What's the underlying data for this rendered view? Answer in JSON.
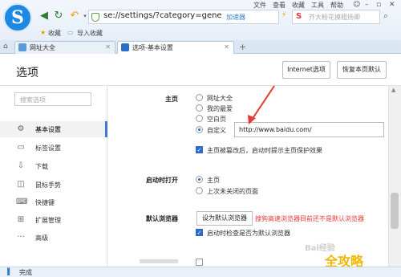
{
  "browser": {
    "logo_letter": "S",
    "address_url": "se://settings/?category=gene",
    "accelerator_label": "加速器",
    "search_placeholder": "芥大粉花摸粗扬卿",
    "menu": [
      "文件",
      "查看",
      "收藏",
      "工具",
      "帮助"
    ],
    "bookmarks": [
      "收藏",
      "导入收藏"
    ],
    "tabs": [
      "网址大全",
      "选项-基本设置"
    ],
    "status_text": "完成"
  },
  "page": {
    "title": "选项",
    "internet_options_button": "Internet选项",
    "restore_defaults_button": "恢复本页默认",
    "sidebar_search_placeholder": "搜索选项",
    "sidebar_items": [
      {
        "icon": "gear-icon",
        "label": "基本设置",
        "active": true
      },
      {
        "icon": "tabs-icon",
        "label": "标签设置",
        "active": false
      },
      {
        "icon": "download-icon",
        "label": "下载",
        "active": false
      },
      {
        "icon": "mouse-gesture-icon",
        "label": "鼠标手势",
        "active": false
      },
      {
        "icon": "shortcut-icon",
        "label": "快捷键",
        "active": false
      },
      {
        "icon": "extensions-icon",
        "label": "扩展管理",
        "active": false
      },
      {
        "icon": "more-icon",
        "label": "高级",
        "active": false
      }
    ]
  },
  "homepage": {
    "section_label": "主页",
    "options": [
      "网址大全",
      "我的最爱",
      "空白页",
      "自定义"
    ],
    "selected": "自定义",
    "custom_url": "http://www.baidu.com/",
    "tamper_warning_label": "主页被篡改后，启动时提示主页保护效果",
    "tamper_warning_checked": true
  },
  "startup": {
    "section_label": "启动时打开",
    "options": [
      "主页",
      "上次未关闭的页面"
    ],
    "selected": "主页"
  },
  "default_browser": {
    "section_label": "默认浏览器",
    "set_button": "设为默认浏览器",
    "warning_text": "搜狗高速浏览器目前还不是默认浏览器",
    "check_on_startup_label": "启动时检查是否为默认浏览器",
    "check_on_startup_checked": true
  },
  "watermark": {
    "brand": "全攻略",
    "faint": "Bai经验"
  },
  "colors": {
    "accent": "#2d6bc8",
    "warning": "#e53935",
    "logo": "#1e88e5",
    "arrow": "#e53935"
  }
}
